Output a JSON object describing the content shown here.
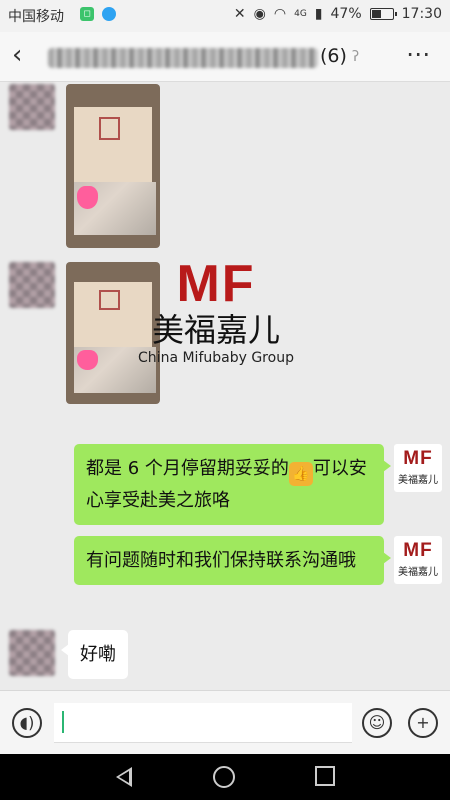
{
  "status_bar": {
    "carrier": "中国移动",
    "network": "4G",
    "battery": "47%",
    "time": "17:30"
  },
  "header": {
    "member_count": "(6)"
  },
  "watermark": {
    "logo": "MF",
    "name_cn": "美福嘉儿",
    "name_en": "China Mifubaby Group"
  },
  "messages": [
    {
      "type": "image",
      "direction": "received",
      "content": "visa-photo"
    },
    {
      "type": "image",
      "direction": "received",
      "content": "visa-photo"
    },
    {
      "type": "text",
      "direction": "sent",
      "text_before": "都是 6 个月停留期妥妥的",
      "emoji": "thumbs-up",
      "text_after": "可以安心享受赴美之旅咯"
    },
    {
      "type": "text",
      "direction": "sent",
      "text": "有问题随时和我们保持联系沟通哦"
    },
    {
      "type": "text",
      "direction": "received",
      "text": "好嘞"
    }
  ],
  "sender_avatar": {
    "logo": "MF",
    "name": "美福嘉儿"
  },
  "colors": {
    "sent_bubble": "#9fe85e",
    "brand_red": "#b81a1a"
  }
}
